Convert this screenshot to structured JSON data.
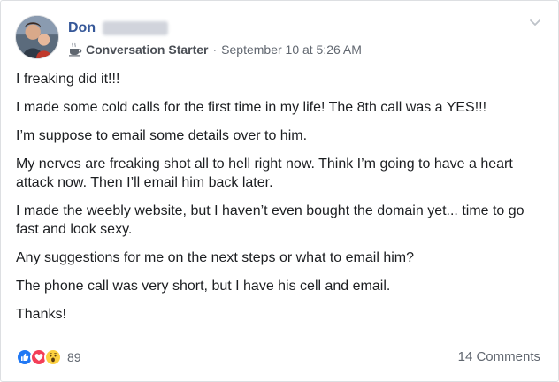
{
  "post": {
    "author_first_name": "Don",
    "badge": {
      "icon": "coffee-cup-icon",
      "label": "Conversation Starter"
    },
    "separator": "·",
    "timestamp": "September 10 at 5:26 AM",
    "paragraphs": [
      "I freaking did it!!!",
      "I made some cold calls for the first time in my life! The 8th call was a YES!!!",
      "I’m suppose to email some details over to him.",
      "My nerves are freaking shot all to hell right now. Think I’m going to have a heart attack now. Then I’ll email him back later.",
      "I made the weebly website, but I haven’t even bought the domain yet... time to go fast and look sexy.",
      "Any suggestions for me on the next steps or what to email him?",
      "The phone call was very short, but I have his cell and email.",
      "Thanks!"
    ]
  },
  "footer": {
    "reaction_icons": [
      "like-icon",
      "love-icon",
      "wow-icon"
    ],
    "reaction_count": "89",
    "comments_label": "14 Comments"
  },
  "colors": {
    "name_link": "#365899",
    "meta_text": "#616770",
    "like_blue": "#2078f4",
    "love_red": "#f33e58",
    "wow_yellow": "#fcd040"
  }
}
